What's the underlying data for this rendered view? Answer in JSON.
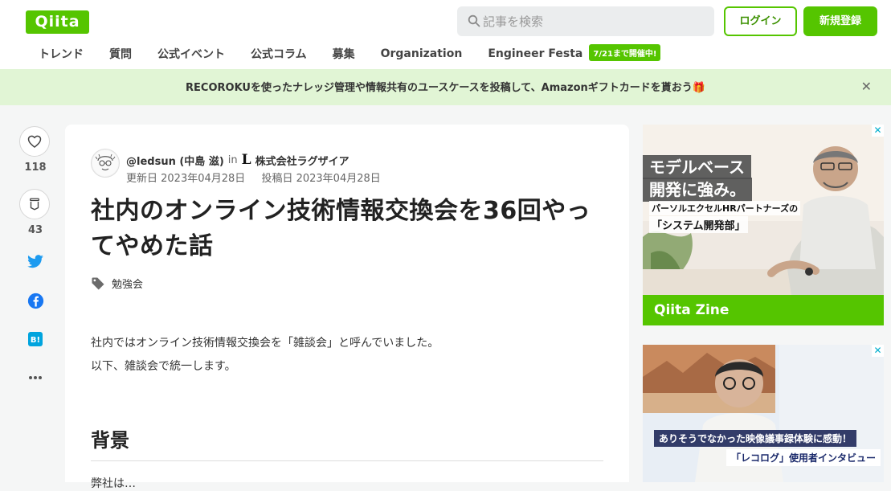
{
  "header": {
    "logo": "Qiita",
    "search_placeholder": "記事を検索",
    "login_label": "ログイン",
    "signup_label": "新規登録",
    "nav": [
      "トレンド",
      "質問",
      "公式イベント",
      "公式コラム",
      "募集",
      "Organization",
      "Engineer Festa"
    ],
    "nav_badge": "7/21まで開催中!"
  },
  "banner": {
    "text": "RECOROKUを使ったナレッジ管理や情報共有のユースケースを投稿して、Amazonギフトカードを貰おう🎁",
    "close": "✕"
  },
  "actions": {
    "likes": "118",
    "stocks": "43",
    "icons": [
      "heart-icon",
      "stock-icon",
      "twitter-icon",
      "facebook-icon",
      "hatena-bookmark-icon",
      "more-icon"
    ]
  },
  "article": {
    "author": "@ledsun (中島 滋)",
    "in_word": "in",
    "org_logo": "L",
    "organization": "株式会社ラグザイア",
    "updated": "更新日 2023年04月28日",
    "posted": "投稿日 2023年04月28日",
    "title": "社内のオンライン技術情報交換会を36回やってやめた話",
    "tags": [
      "勉強会"
    ],
    "paragraphs": [
      "社内ではオンライン技術情報交換会を「雑談会」と呼んでいました。",
      "以下、雑談会で統一します。"
    ],
    "heading": "背景",
    "next_text": "弊社は…"
  },
  "ads": {
    "ad1": {
      "headline1": "モデルベース",
      "headline2": "開発に強み。",
      "sub1": "パーソルエクセルHRパートナーズの",
      "sub2": "「システム開発部」",
      "brand": "Qiita Zine"
    },
    "ad2": {
      "line1": "ありそうでなかった映像議事録体験に感動！",
      "line2": "「レコログ」使用者インタビュー"
    },
    "close_mark": "✕"
  },
  "colors": {
    "brand": "#55c500",
    "banner_bg": "#e1f5d5",
    "page_bg": "#f5f6f6"
  }
}
